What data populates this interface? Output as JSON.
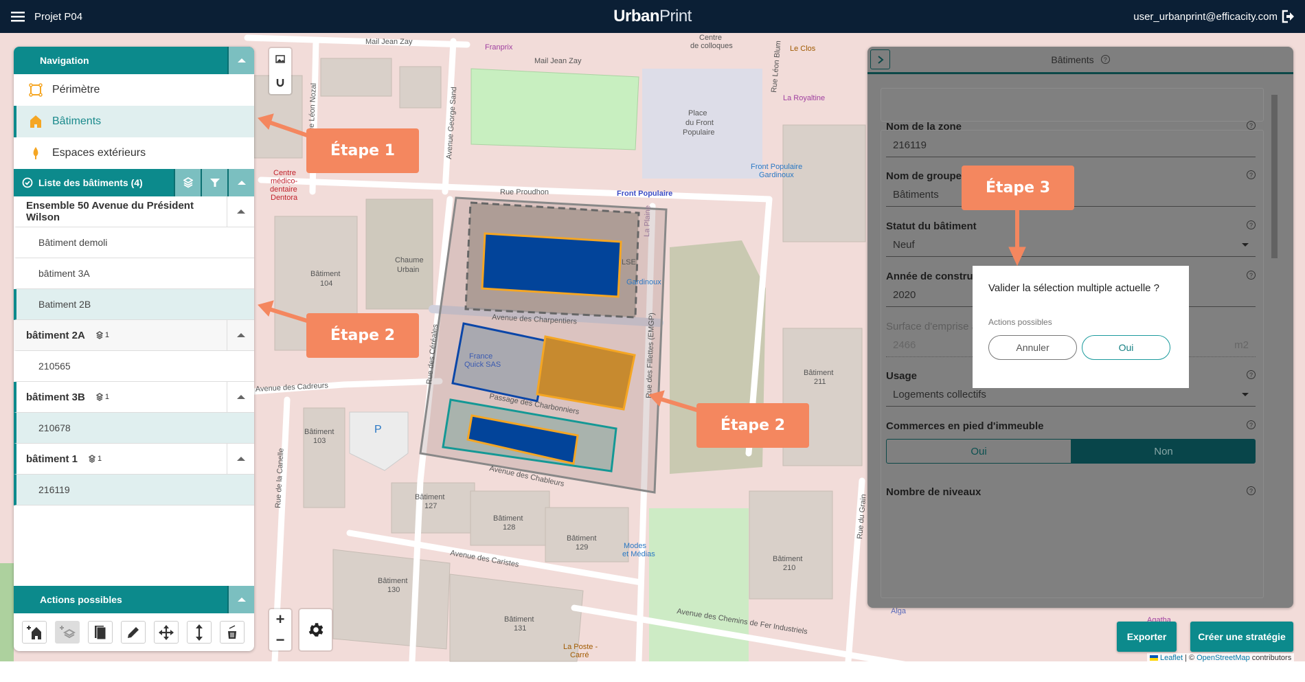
{
  "header": {
    "project": "Projet P04",
    "logo_bold": "Urban",
    "logo_light": "Print",
    "user": "user_urbanprint@efficacity.com"
  },
  "navigation": {
    "title": "Navigation",
    "items": [
      {
        "label": "Périmètre",
        "icon": "perimeter-icon"
      },
      {
        "label": "Bâtiments",
        "icon": "building-icon",
        "active": true
      },
      {
        "label": "Espaces extérieurs",
        "icon": "tree-icon"
      }
    ]
  },
  "building_list": {
    "title": "Liste des bâtiments (4)",
    "groups": [
      {
        "name": "Ensemble 50 Avenue du Président Wilson",
        "items": [
          "Bâtiment demoli",
          "bâtiment 3A",
          "Batiment 2B"
        ]
      },
      {
        "name": "bâtiment 2A",
        "count": "1",
        "items": [
          "210565"
        ]
      },
      {
        "name": "bâtiment 3B",
        "count": "1",
        "items": [
          "210678"
        ]
      },
      {
        "name": "bâtiment 1",
        "count": "1",
        "items": [
          "216119"
        ]
      }
    ]
  },
  "actions": {
    "title": "Actions possibles",
    "tools": [
      "add-building-icon",
      "add-layer-icon",
      "copy-icon",
      "pencil-icon",
      "move-icon",
      "vertical-resize-icon",
      "trash-icon"
    ]
  },
  "map": {
    "labels": [
      "Rue Proudhon",
      "Front Populaire",
      "Avenue des Charpentiers",
      "Passage des Charbonniers",
      "Avenue des Chableurs",
      "Avenue des Caristes",
      "Avenue des Cadreurs",
      "Rue des Céréales",
      "Rue des Fillettes (EMGP)",
      "Rue de la Canelle",
      "Avenue George Sand",
      "Rue Léon Nozal",
      "Mail Jean Zay",
      "Mail Jean Zay",
      "Place",
      "du Front",
      "Populaire",
      "Rue Léon Blum",
      "Gardinoux",
      "Modes",
      "et Médias",
      "La Poste -",
      "Carré",
      "Avenue des Chemins de Fer Industriels",
      "France",
      "Quick SAS",
      "Bâtiment",
      "104",
      "Chaume",
      "Urbain",
      "Bâtiment",
      "103",
      "Bâtiment",
      "127",
      "Bâtiment",
      "128",
      "Bâtiment",
      "129",
      "Bâtiment",
      "130",
      "Bâtiment",
      "131",
      "Bâtiment",
      "211",
      "Bâtiment",
      "210",
      "Centre",
      "médico-",
      "dentaire",
      "Dentora",
      "Franprix",
      "Centre",
      "de colloques",
      "Le Clos",
      "La Royaltine",
      "Front Populaire",
      "Gardinoux",
      "La Plaine",
      "LSE",
      "P",
      "Rue du Grain",
      "Alga",
      "Agatha"
    ],
    "attribution": {
      "leaflet": "Leaflet",
      "sep": "| ©",
      "osm": "OpenStreetMap",
      "suffix": "contributors"
    }
  },
  "right_panel": {
    "title": "Bâtiments",
    "fields": {
      "zone": {
        "label": "Nom de la zone",
        "value": "216119"
      },
      "groupe": {
        "label": "Nom de groupe (facultatif)",
        "value": "Bâtiments"
      },
      "statut": {
        "label": "Statut du bâtiment",
        "value": "Neuf"
      },
      "annee": {
        "label": "Année de construction",
        "value": "2020"
      },
      "surface": {
        "label": "Surface d'emprise au sol",
        "value": "2466",
        "unit": "m2"
      },
      "usage": {
        "label": "Usage",
        "value": "Logements collectifs"
      },
      "commerces": {
        "label": "Commerces en pied d'immeuble",
        "options": [
          "Oui",
          "Non"
        ],
        "selected": "Non"
      },
      "niveaux": {
        "label": "Nombre de niveaux"
      }
    }
  },
  "dialog": {
    "question": "Valider la sélection multiple actuelle ?",
    "subtitle": "Actions possibles",
    "cancel": "Annuler",
    "confirm": "Oui"
  },
  "footer_buttons": {
    "export": "Exporter",
    "strategy": "Créer une stratégie"
  },
  "callouts": {
    "etape1": "Étape 1",
    "etape2": "Étape 2",
    "etape3": "Étape 3"
  },
  "colors": {
    "header": "#0b1f35",
    "teal": "#0c8a8c",
    "callout": "#f4875f",
    "selection_blue": "#02449a",
    "selection_orange": "#f5a623"
  }
}
